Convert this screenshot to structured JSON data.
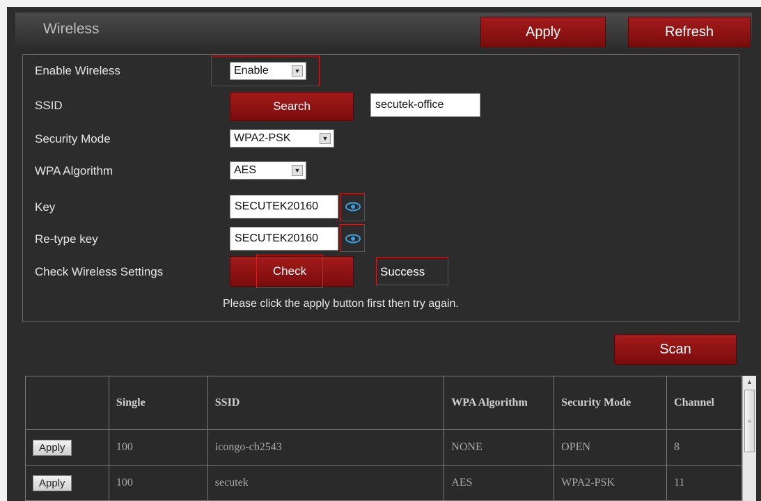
{
  "header": {
    "title": "Wireless",
    "apply_label": "Apply",
    "refresh_label": "Refresh"
  },
  "form": {
    "enable_wireless": {
      "label": "Enable Wireless",
      "value": "Enable"
    },
    "ssid": {
      "label": "SSID",
      "search_label": "Search",
      "value": "secutek-office"
    },
    "security_mode": {
      "label": "Security Mode",
      "value": "WPA2-PSK"
    },
    "wpa_algorithm": {
      "label": "WPA Algorithm",
      "value": "AES"
    },
    "key": {
      "label": "Key",
      "value": "SECUTEK20160"
    },
    "retype_key": {
      "label": "Re-type key",
      "value": "SECUTEK20160"
    },
    "check": {
      "label": "Check Wireless Settings",
      "button_label": "Check",
      "status": "Success"
    },
    "note": "Please click the apply button first then try again."
  },
  "scan": {
    "button_label": "Scan"
  },
  "table": {
    "headers": [
      "",
      "Single",
      "SSID",
      "WPA Algorithm",
      "Security Mode",
      "Channel"
    ],
    "rows": [
      {
        "action": "Apply",
        "single": "100",
        "ssid": "icongo-cb2543",
        "wpa": "NONE",
        "mode": "OPEN",
        "channel": "8"
      },
      {
        "action": "Apply",
        "single": "100",
        "ssid": "secutek",
        "wpa": "AES",
        "mode": "WPA2-PSK",
        "channel": "11"
      }
    ]
  },
  "colors": {
    "accent_red": "#a31b1b",
    "panel_bg": "#2c2c2c",
    "highlight_box": "#d02020",
    "eye_icon": "#3aa0e0"
  },
  "icons": {
    "dropdown": "chevron-down-icon",
    "show_password": "eye-icon",
    "scroll_up": "chevron-up-icon"
  }
}
